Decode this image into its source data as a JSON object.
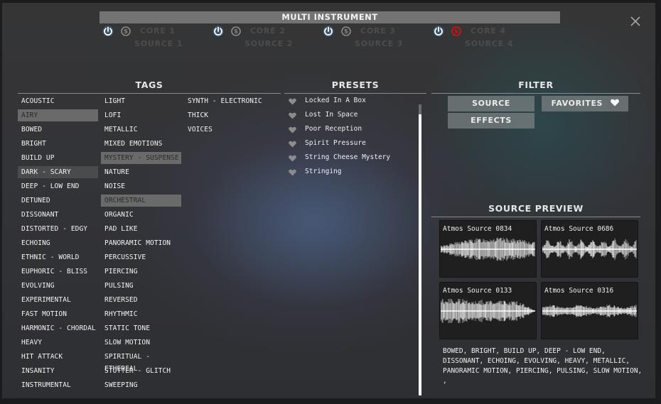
{
  "header": {
    "title": "MULTI INSTRUMENT",
    "cores": [
      {
        "core": "CORE 1",
        "source": "SOURCE 1",
        "power_on": true,
        "solo_active": false
      },
      {
        "core": "CORE 2",
        "source": "SOURCE 2",
        "power_on": true,
        "solo_active": false
      },
      {
        "core": "CORE 3",
        "source": "SOURCE 3",
        "power_on": true,
        "solo_active": false
      },
      {
        "core": "CORE 4",
        "source": "SOURCE 4",
        "power_on": true,
        "solo_active": true
      }
    ],
    "solo_glyph": "S",
    "close_icon": "close-icon"
  },
  "tags": {
    "title": "TAGS",
    "columns": [
      [
        "ACOUSTIC",
        "AIRY",
        "BOWED",
        "BRIGHT",
        "BUILD UP",
        "DARK - SCARY",
        "DEEP - LOW END",
        "DETUNED",
        "DISSONANT",
        "DISTORTED - EDGY",
        "ECHOING",
        "ETHNIC - WORLD",
        "EUPHORIC - BLISS",
        "EVOLVING",
        "EXPERIMENTAL",
        "FAST MOTION",
        "HARMONIC - CHORDAL",
        "HEAVY",
        "HIT ATTACK",
        "INSANITY",
        "INSTRUMENTAL"
      ],
      [
        "LIGHT",
        "LOFI",
        "METALLIC",
        "MIXED EMOTIONS",
        "MYSTERY - SUSPENSE",
        "NATURE",
        "NOISE",
        "ORCHESTRAL",
        "ORGANIC",
        "PAD LIKE",
        "PANORAMIC MOTION",
        "PERCUSSIVE",
        "PIERCING",
        "PULSING",
        "REVERSED",
        "RHYTHMIC",
        "STATIC TONE",
        "SLOW MOTION",
        "SPIRITUAL - ETHEREAL",
        "STUTTER - GLITCH",
        "SWEEPING"
      ],
      [
        "SYNTH - ELECTRONIC",
        "THICK",
        "VOICES"
      ]
    ],
    "selected": [
      "AIRY",
      "MYSTERY - SUSPENSE",
      "ORCHESTRAL"
    ],
    "hovered": [
      "DARK - SCARY"
    ]
  },
  "presets": {
    "title": "PRESETS",
    "items": [
      {
        "name": "Locked In A Box",
        "favorite": false
      },
      {
        "name": "Lost In Space",
        "favorite": false
      },
      {
        "name": "Poor Reception",
        "favorite": false
      },
      {
        "name": "Spirit Pressure",
        "favorite": false
      },
      {
        "name": "String Cheese Mystery",
        "favorite": false
      },
      {
        "name": "Stringing",
        "favorite": false
      }
    ]
  },
  "filter": {
    "title": "FILTER",
    "source_label": "SOURCE",
    "effects_label": "EFFECTS",
    "favorites_label": "FAVORITES",
    "favorites_icon": "heart-icon"
  },
  "source_preview": {
    "title": "SOURCE PREVIEW",
    "sources": [
      {
        "name": "Atmos Source 0834",
        "shape": "swell"
      },
      {
        "name": "Atmos Source 0686",
        "shape": "pulses"
      },
      {
        "name": "Atmos Source 0133",
        "shape": "decay"
      },
      {
        "name": "Atmos Source 0316",
        "shape": "flat"
      }
    ],
    "tags_text": "BOWED, BRIGHT, BUILD UP, DEEP - LOW END, DISSONANT, ECHOING, EVOLVING, HEAVY, METALLIC, PANORAMIC MOTION, PIERCING, PULSING, SLOW MOTION, ,"
  },
  "colors": {
    "power_on": "#ffffff",
    "power_glow": "#4a9ad6",
    "solo_off": "#8a8a8a",
    "solo_on": "#e01010",
    "tag_selected_bg": "#6a6a6a",
    "tag_hover_bg": "#4a4b4d"
  }
}
